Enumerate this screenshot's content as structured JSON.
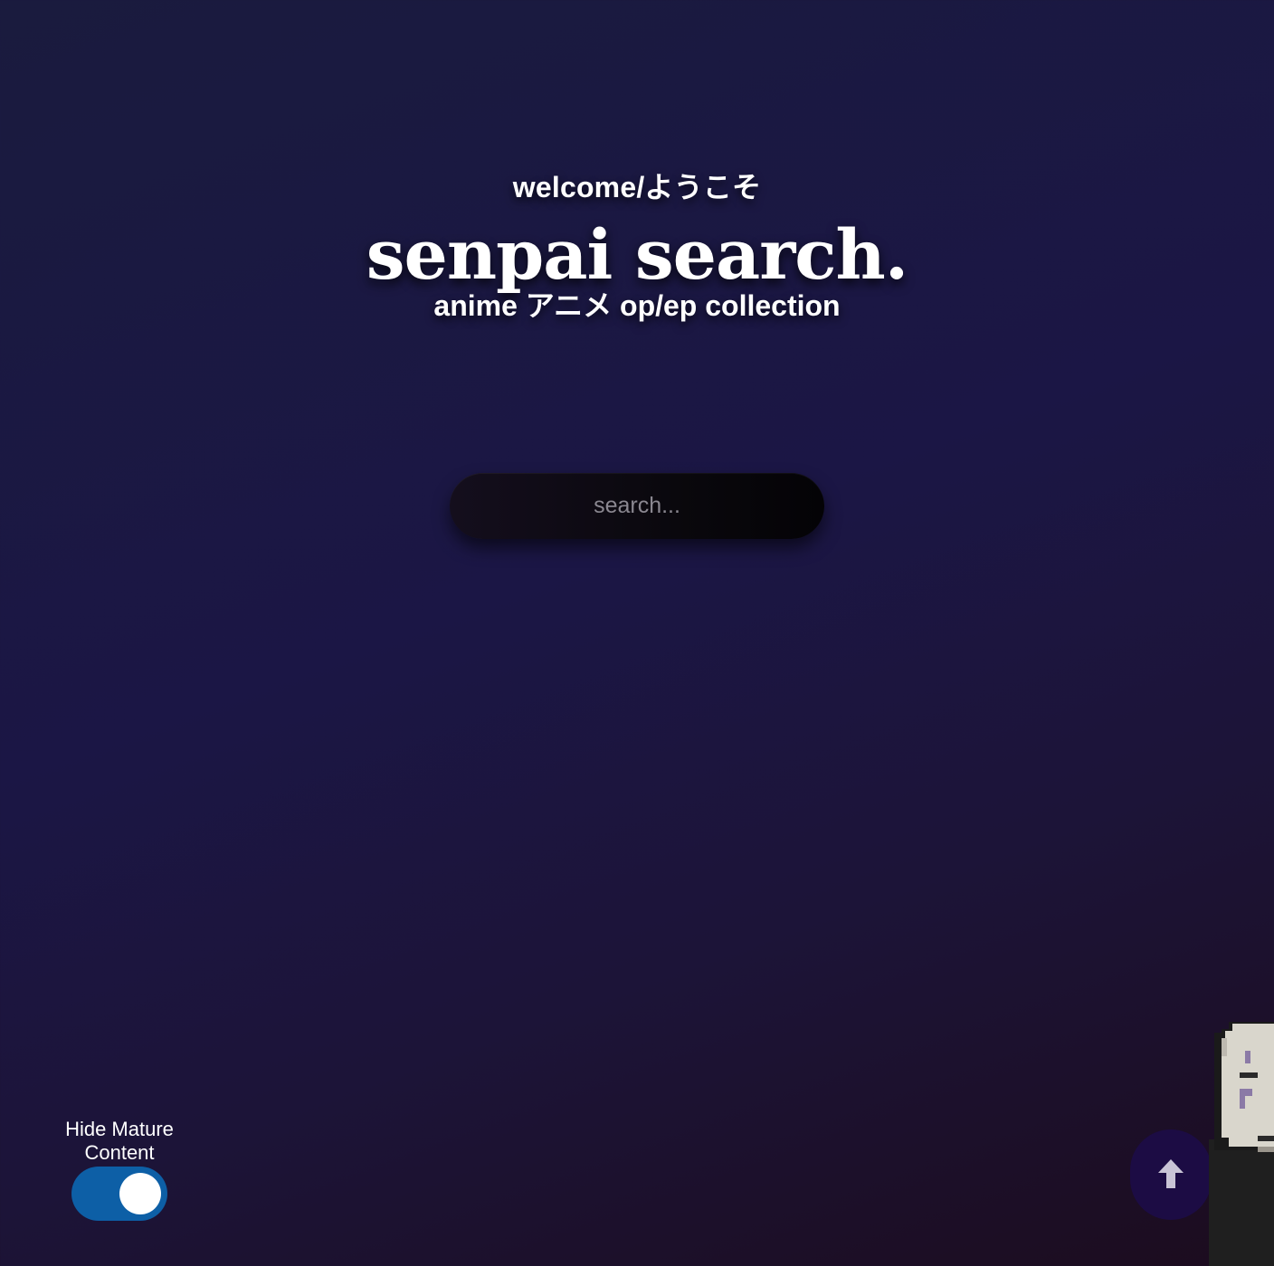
{
  "hero": {
    "welcome": "welcome/ようこそ",
    "title": "senpai search.",
    "subtitle": "anime アニメ op/ep collection"
  },
  "search": {
    "placeholder": "search...",
    "value": ""
  },
  "settings": {
    "mature_label": "Hide Mature Content",
    "mature_enabled": true
  },
  "icons": {
    "scroll_top": "arrow-up-icon",
    "mascot": "pixel-mascot-icon"
  },
  "colors": {
    "background_start": "#1a1b3e",
    "background_end": "#1c0c1e",
    "toggle_on": "#0d5fa6",
    "scroll_button": "#1c0c44"
  }
}
